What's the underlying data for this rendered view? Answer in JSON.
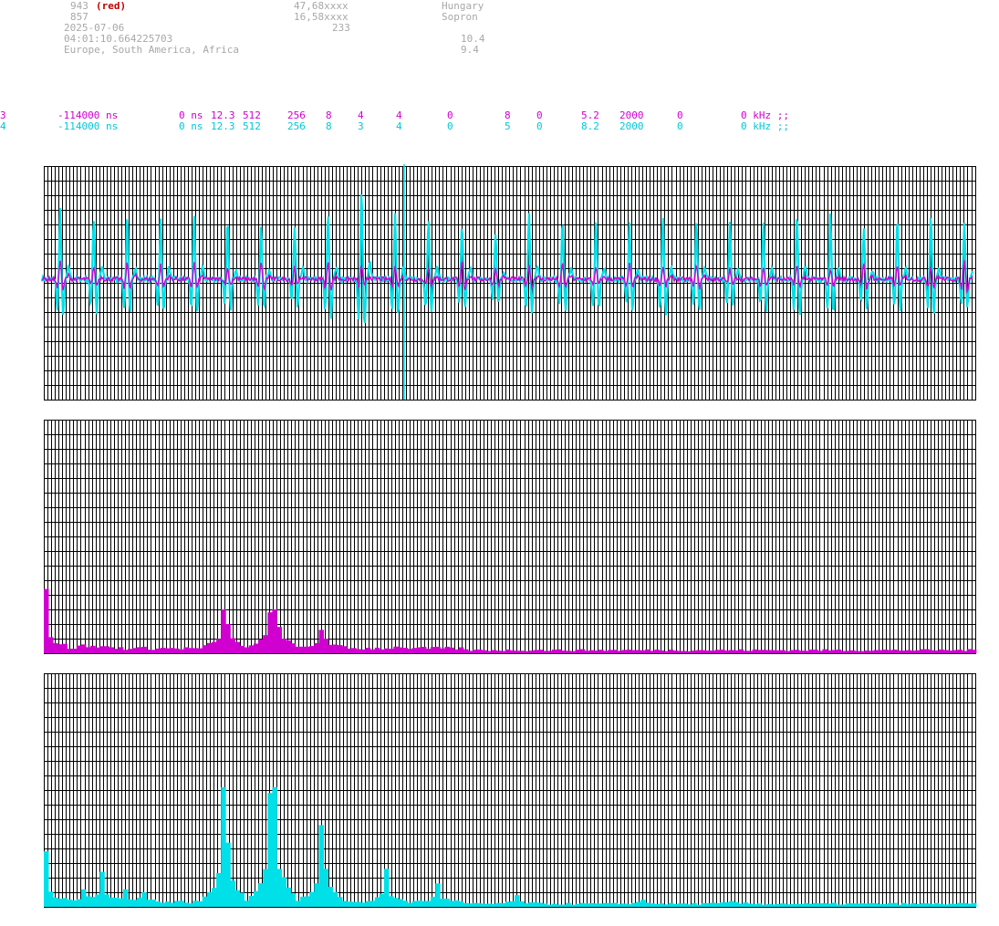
{
  "header": {
    "station_id": "943",
    "station_color": "(red)",
    "second_id": "857",
    "lat": "47,68xxxx",
    "lon": "16,58xxxx",
    "value_233": "233",
    "country": "Hungary",
    "city": "Sopron",
    "date": "2025-07-06",
    "time": "04:01:10.664225703",
    "regions": "Europe, South America, Africa",
    "value_a": "10.4",
    "value_b": "9.4"
  },
  "params": [
    {
      "id": "3",
      "offset": "-114000 ns",
      "zero": "0 ns",
      "v1": "12.3",
      "v2": "512",
      "v3": "256",
      "v4": "8",
      "v5": "4",
      "v6": "4",
      "v7": "0",
      "v8": "8",
      "v9": "0",
      "v10": "5.2",
      "v11": "2000",
      "v12": "0",
      "unit": "0 kHz ;;"
    },
    {
      "id": "4",
      "offset": "-114000 ns",
      "zero": "0 ns",
      "v1": "12.3",
      "v2": "512",
      "v3": "256",
      "v4": "8",
      "v5": "3",
      "v6": "4",
      "v7": "0",
      "v8": "5",
      "v9": "0",
      "v10": "8.2",
      "v11": "2000",
      "v12": "0",
      "unit": "0 kHz ;;"
    }
  ],
  "colors": {
    "magenta": "#d000d0",
    "cyan": "#00e0e8",
    "grid": "#000000"
  },
  "chart_data": [
    {
      "type": "line",
      "series": [
        {
          "color": "magenta",
          "peaks": [
            -1.0,
            -0.6,
            -0.9,
            -0.7,
            -0.8,
            -0.5,
            -0.9,
            -0.6,
            -0.8,
            -0.7,
            -0.6,
            -0.5,
            -0.9,
            -0.6,
            -0.7,
            -0.8,
            -0.5,
            -0.7,
            -0.6,
            -0.8,
            -0.5,
            -0.6,
            -0.7,
            -0.5,
            -0.8,
            -0.6,
            -0.7
          ]
        },
        {
          "color": "cyan",
          "peaks": [
            1.0,
            0.9,
            0.95,
            0.9,
            0.9,
            0.85,
            0.8,
            0.75,
            1.0,
            1.3,
            0.95,
            0.9,
            0.8,
            0.65,
            0.95,
            0.85,
            0.85,
            0.8,
            0.95,
            0.85,
            0.8,
            0.85,
            0.95,
            0.95,
            0.75,
            0.9,
            0.95,
            0.8
          ]
        }
      ],
      "ylim": [
        -1.6,
        1.6
      ],
      "grid": true
    },
    {
      "type": "bar",
      "series": [
        {
          "color": "magenta",
          "peaks": [
            [
              0,
              11.0
            ],
            [
              38,
              7.5
            ],
            [
              39,
              5.0
            ],
            [
              48,
              7.0
            ],
            [
              49,
              7.5
            ],
            [
              50,
              4.5
            ],
            [
              59,
              4.0
            ],
            [
              60,
              2.5
            ],
            [
              8,
              1.5
            ],
            [
              12,
              1.2
            ],
            [
              76,
              1.0
            ]
          ]
        }
      ],
      "ylim": [
        0,
        40
      ],
      "grid": true
    },
    {
      "type": "bar",
      "series": [
        {
          "color": "cyan",
          "peaks": [
            [
              0,
              9.5
            ],
            [
              38,
              20.5
            ],
            [
              39,
              11.0
            ],
            [
              48,
              19.5
            ],
            [
              49,
              20.5
            ],
            [
              50,
              6.5
            ],
            [
              59,
              14.0
            ],
            [
              60,
              6.5
            ],
            [
              73,
              6.5
            ],
            [
              84,
              4.0
            ],
            [
              4,
              1.5
            ],
            [
              8,
              3.0
            ],
            [
              12,
              6.0
            ],
            [
              17,
              3.0
            ],
            [
              21,
              2.5
            ],
            [
              101,
              2.0
            ],
            [
              128,
              1.2
            ],
            [
              147,
              1.0
            ]
          ]
        }
      ],
      "ylim": [
        0,
        40
      ],
      "grid": true
    }
  ]
}
